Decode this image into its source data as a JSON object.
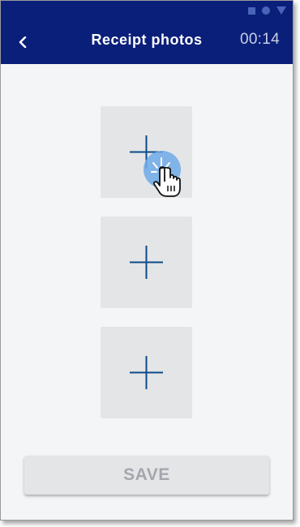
{
  "app_bar": {
    "title": "Receipt photos",
    "timer": "00:14",
    "back_icon": "chevron-left-icon"
  },
  "status_bar": {
    "icons": [
      "square-icon",
      "circle-icon",
      "triangle-icon"
    ]
  },
  "photo_slots": [
    {
      "icon": "plus-icon"
    },
    {
      "icon": "plus-icon"
    },
    {
      "icon": "plus-icon"
    }
  ],
  "save_button": {
    "label": "SAVE",
    "enabled": false
  },
  "colors": {
    "app_bar": "#0a1f7a",
    "accent": "#0b4a8a",
    "background": "#f4f5f6",
    "slot": "#e4e5e7",
    "disabled_text": "#a3a7ad"
  }
}
